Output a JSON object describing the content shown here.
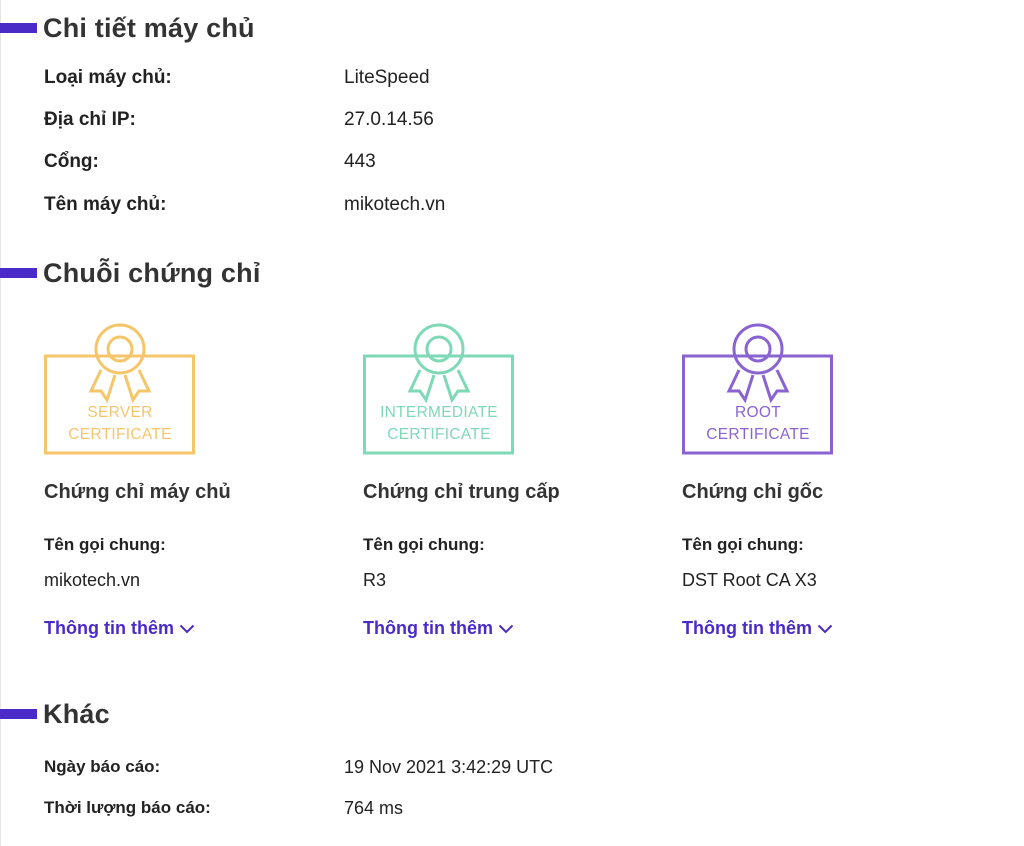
{
  "server_details": {
    "title": "Chi tiết máy chủ",
    "rows": [
      {
        "label": "Loại máy chủ:",
        "value": "LiteSpeed"
      },
      {
        "label": "Địa chỉ IP:",
        "value": "27.0.14.56"
      },
      {
        "label": "Cổng:",
        "value": "443"
      },
      {
        "label": "Tên máy chủ:",
        "value": "mikotech.vn"
      }
    ]
  },
  "chain": {
    "title": "Chuỗi chứng chỉ",
    "certificates": [
      {
        "badge_line1": "SERVER",
        "badge_line2": "CERTIFICATE",
        "badge_color": "#f5c56a",
        "title": "Chứng chỉ máy chủ",
        "cn_label": "Tên gọi chung:",
        "cn_value": "mikotech.vn",
        "more_label": "Thông tin thêm"
      },
      {
        "badge_line1": "INTERMEDIATE",
        "badge_line2": "CERTIFICATE",
        "badge_color": "#7fd9b6",
        "title": "Chứng chỉ trung cấp",
        "cn_label": "Tên gọi chung:",
        "cn_value": "R3",
        "more_label": "Thông tin thêm"
      },
      {
        "badge_line1": "ROOT",
        "badge_line2": "CERTIFICATE",
        "badge_color": "#8a63d2",
        "title": "Chứng chỉ gốc",
        "cn_label": "Tên gọi chung:",
        "cn_value": "DST Root CA X3",
        "more_label": "Thông tin thêm"
      }
    ]
  },
  "other": {
    "title": "Khác",
    "rows": [
      {
        "label": "Ngày báo cáo:",
        "value": "19 Nov 2021 3:42:29 UTC"
      },
      {
        "label": "Thời lượng báo cáo:",
        "value": "764 ms"
      }
    ]
  },
  "icons": {
    "section_marker": "section-bar-icon",
    "badge": "certificate-ribbon-icon",
    "expand": "chevron-down-icon"
  },
  "colors": {
    "accent": "#4a2bc8",
    "text": "#222222"
  }
}
